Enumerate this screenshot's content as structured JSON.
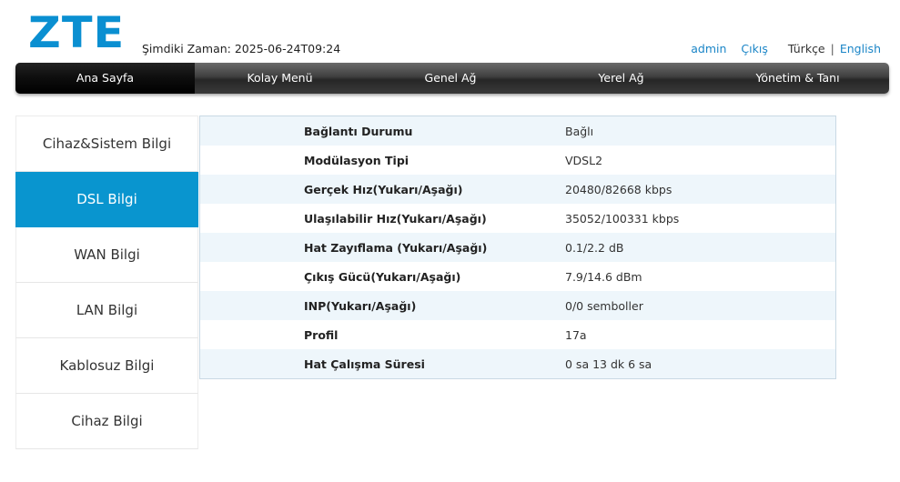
{
  "header": {
    "logo": "ZTE",
    "time_label": "Şimdiki Zaman: 2025-06-24T09:24",
    "user": "admin",
    "logout": "Çıkış",
    "lang_tr": "Türkçe",
    "lang_sep": "|",
    "lang_en": "English"
  },
  "nav": {
    "items": [
      {
        "label": "Ana Sayfa"
      },
      {
        "label": "Kolay Menü"
      },
      {
        "label": "Genel Ağ"
      },
      {
        "label": "Yerel Ağ"
      },
      {
        "label": "Yönetim & Tanı"
      }
    ],
    "active_index": 0
  },
  "sidebar": {
    "items": [
      {
        "label": "Cihaz&Sistem Bilgi"
      },
      {
        "label": "DSL Bilgi"
      },
      {
        "label": "WAN Bilgi"
      },
      {
        "label": "LAN Bilgi"
      },
      {
        "label": "Kablosuz Bilgi"
      },
      {
        "label": "Cihaz Bilgi"
      }
    ],
    "active_index": 1
  },
  "dsl_info": {
    "rows": [
      {
        "label": "Bağlantı Durumu",
        "value": "Bağlı"
      },
      {
        "label": "Modülasyon Tipi",
        "value": "VDSL2"
      },
      {
        "label": "Gerçek Hız(Yukarı/Aşağı)",
        "value": "20480/82668 kbps"
      },
      {
        "label": "Ulaşılabilir Hız(Yukarı/Aşağı)",
        "value": "35052/100331 kbps"
      },
      {
        "label": "Hat Zayıflama (Yukarı/Aşağı)",
        "value": "0.1/2.2 dB"
      },
      {
        "label": "Çıkış Gücü(Yukarı/Aşağı)",
        "value": "7.9/14.6 dBm"
      },
      {
        "label": "INP(Yukarı/Aşağı)",
        "value": "0/0 semboller"
      },
      {
        "label": "Profil",
        "value": "17a"
      },
      {
        "label": "Hat Çalışma Süresi",
        "value": "0 sa 13 dk 6 sa"
      }
    ]
  },
  "colors": {
    "brand": "#0a8fd1",
    "sidebar_active": "#0995cf",
    "link": "#1a85c7",
    "row_alt": "#eef6fb"
  }
}
